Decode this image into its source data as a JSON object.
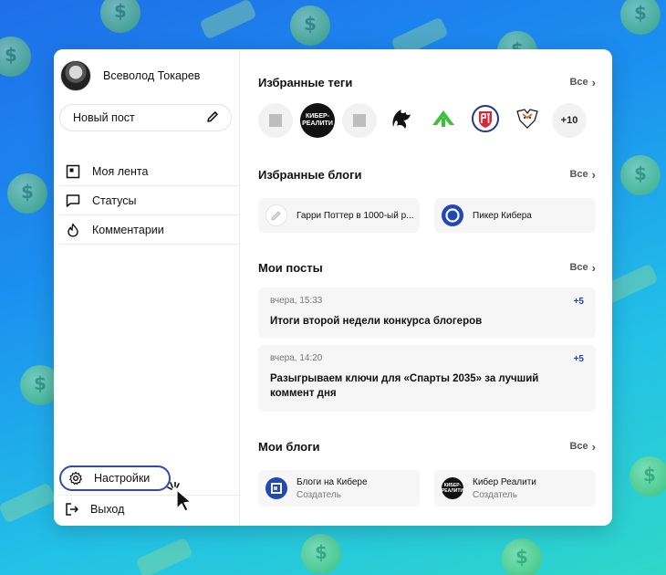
{
  "user": {
    "name": "Всеволод Токарев"
  },
  "new_post": {
    "label": "Новый пост",
    "icon": "pencil-icon"
  },
  "nav": [
    {
      "label": "Моя лента",
      "icon": "feed-icon"
    },
    {
      "label": "Статусы",
      "icon": "chat-icon"
    },
    {
      "label": "Комментарии",
      "icon": "flame-icon"
    }
  ],
  "settings": {
    "label": "Настройки",
    "icon": "gear-icon"
  },
  "logout": {
    "label": "Выход",
    "icon": "logout-icon"
  },
  "favorite_tags": {
    "title": "Избранные теги",
    "all_label": "Все",
    "tags": [
      {
        "icon": "placeholder-icon"
      },
      {
        "icon": "kiber-realnost-logo",
        "text": "КИБЕР-\nРЕАЛИТИ"
      },
      {
        "icon": "placeholder-icon"
      },
      {
        "icon": "dragon-logo-icon"
      },
      {
        "icon": "green-arrow-logo-icon"
      },
      {
        "icon": "shield-logo-icon"
      },
      {
        "icon": "virtus-pro-logo-icon"
      }
    ],
    "more_label": "+10"
  },
  "favorite_blogs": {
    "title": "Избранные блоги",
    "all_label": "Все",
    "items": [
      {
        "name": "Гарри Поттер в 1000-ый р...",
        "icon": "pencil-icon"
      },
      {
        "name": "Пикер Кибера",
        "icon": "blue-circle-logo-icon"
      }
    ]
  },
  "my_posts": {
    "title": "Мои посты",
    "all_label": "Все",
    "items": [
      {
        "time": "вчера, 15:33",
        "count": "+5",
        "title": "Итоги второй недели конкурса блогеров"
      },
      {
        "time": "вчера, 14:20",
        "count": "+5",
        "title": "Разыгрываем ключи для «Спарты 2035» за лучший коммент дня"
      }
    ]
  },
  "my_blogs": {
    "title": "Мои блоги",
    "all_label": "Все",
    "items": [
      {
        "name": "Блоги на Кибере",
        "role": "Создатель",
        "icon": "kiber-blue-logo-icon"
      },
      {
        "name": "Кибер Реалити",
        "role": "Создатель",
        "icon": "kiber-realnost-logo"
      }
    ]
  },
  "colors": {
    "accent": "#2447b8",
    "settings_outline": "#2f4bb4"
  }
}
